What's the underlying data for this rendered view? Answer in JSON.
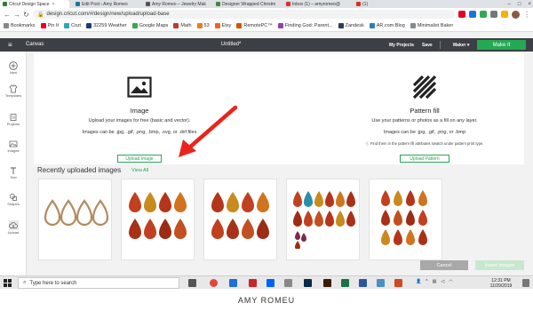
{
  "browser": {
    "tabs": [
      {
        "label": "Cricut Design Space",
        "color": "#2e7d32"
      },
      {
        "label": "Edit Post ‹ Amy Romeo",
        "color": "#21759b"
      },
      {
        "label": "Amy Romeo – Jewelry Mak",
        "color": "#555"
      },
      {
        "label": "Designer Wrapped Christm",
        "color": "#3d8b3d"
      },
      {
        "label": "Inbox (1) – amyromeo@",
        "color": "#d93025"
      },
      {
        "label": "(1)",
        "color": "#d93025"
      }
    ],
    "url": "design.cricut.com/#/design/new/upload/upload-base",
    "bookmarks": [
      {
        "label": "Bookmarks",
        "color": "#888"
      },
      {
        "label": "Pin It",
        "color": "#e60023"
      },
      {
        "label": "Cozi",
        "color": "#2aa7b8"
      },
      {
        "label": "32259 Weather",
        "color": "#1f3a7a"
      },
      {
        "label": "Google Maps",
        "color": "#34a853"
      },
      {
        "label": "Math",
        "color": "#c0392b"
      },
      {
        "label": "53",
        "color": "#e67e22"
      },
      {
        "label": "Etsy",
        "color": "#f1641e"
      },
      {
        "label": "RemotePC™",
        "color": "#d35400"
      },
      {
        "label": "Finding God: Parent...",
        "color": "#8e44ad"
      },
      {
        "label": "Zandesk",
        "color": "#2c3e50"
      },
      {
        "label": "AR.com Blog",
        "color": "#2980b9"
      },
      {
        "label": "Minimalist Baker",
        "color": "#7f8c8d"
      }
    ]
  },
  "app": {
    "section": "Canvas",
    "doc_title": "Untitled*",
    "my_projects": "My Projects",
    "save": "Save",
    "machine": "Maker",
    "make_it": "Make It"
  },
  "rail": [
    {
      "label": "New",
      "icon": "plus-icon"
    },
    {
      "label": "Templates",
      "icon": "shirt-icon"
    },
    {
      "label": "Projects",
      "icon": "projects-icon"
    },
    {
      "label": "Images",
      "icon": "image-icon"
    },
    {
      "label": "Text",
      "icon": "text-icon"
    },
    {
      "label": "Shapes",
      "icon": "shapes-icon"
    },
    {
      "label": "Upload",
      "icon": "upload-icon"
    }
  ],
  "upload": {
    "image_title": "Image",
    "image_desc": "Upload your images for free (basic and vector).",
    "image_formats": "Images can be .jpg, .gif, .png, .bmp, .svg, or .dxf files",
    "image_button": "Upload Image",
    "pattern_title": "Pattern fill",
    "pattern_desc": "Use your patterns or photos as a fill on any layer.",
    "pattern_formats": "Images can be .jpg, .gif, .png, or .bmp",
    "pattern_note": "Find them in the pattern fill attributes swatch under pattern print type.",
    "pattern_button": "Upload Pattern"
  },
  "recent": {
    "title": "Recently uploaded images",
    "view_all": "View All"
  },
  "actions": {
    "cancel": "Cancel",
    "insert": "Insert Images"
  },
  "taskbar": {
    "search_placeholder": "Type here to search",
    "time": "12:31 PM",
    "date": "11/29/2019"
  },
  "caption": "AMY ROMEU",
  "colors": {
    "accent": "#25a854",
    "header": "#3c3f44",
    "arrow": "#e8251c"
  }
}
